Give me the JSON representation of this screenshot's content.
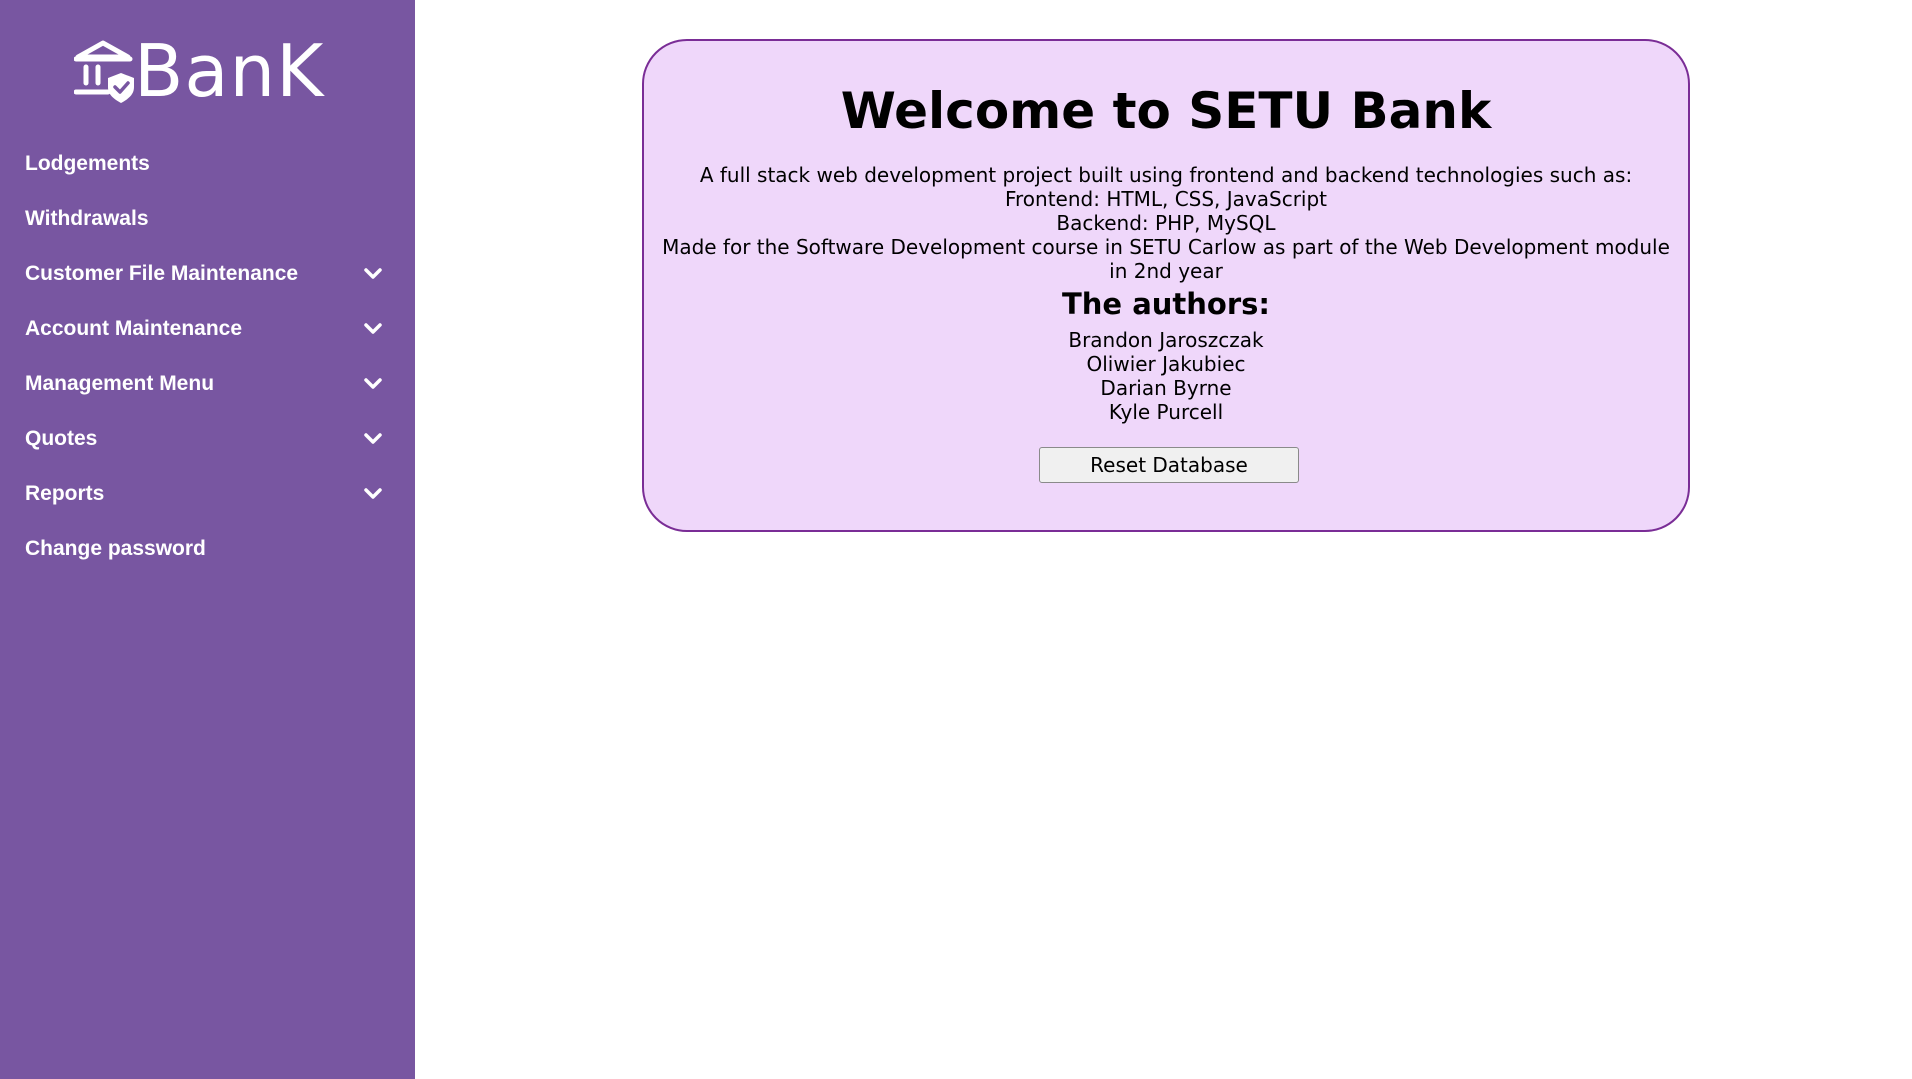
{
  "brand": {
    "logo_text": "BanK",
    "logo_icon": "bank-shield-icon",
    "sidebar_color": "#7856a1",
    "card_color": "#efd7fa",
    "card_border_color": "#7a2d96"
  },
  "sidebar": {
    "items": [
      {
        "label": "Lodgements",
        "has_dropdown": false
      },
      {
        "label": "Withdrawals",
        "has_dropdown": false
      },
      {
        "label": "Customer File Maintenance",
        "has_dropdown": true,
        "icon": "chevron-down-icon"
      },
      {
        "label": "Account Maintenance",
        "has_dropdown": true,
        "icon": "chevron-down-icon"
      },
      {
        "label": "Management Menu",
        "has_dropdown": true,
        "icon": "chevron-down-icon"
      },
      {
        "label": "Quotes",
        "has_dropdown": true,
        "icon": "chevron-down-icon"
      },
      {
        "label": "Reports",
        "has_dropdown": true,
        "icon": "chevron-down-icon"
      },
      {
        "label": "Change password",
        "has_dropdown": false
      }
    ]
  },
  "main": {
    "title": "Welcome to SETU Bank",
    "description": [
      "A full stack web development project built using frontend and backend technologies such as:",
      "Frontend: HTML, CSS, JavaScript",
      "Backend: PHP, MySQL",
      "Made for the Software Development course in SETU Carlow as part of the Web Development module in 2nd year"
    ],
    "authors_heading": "The authors:",
    "authors": [
      "Brandon Jaroszczak",
      "Oliwier Jakubiec",
      "Darian Byrne",
      "Kyle Purcell"
    ],
    "reset_button_label": "Reset Database"
  }
}
